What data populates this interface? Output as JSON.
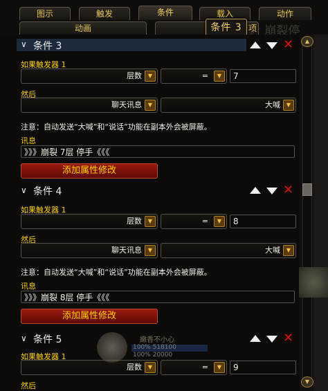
{
  "tabs": [
    {
      "label": "图示"
    },
    {
      "label": "触发"
    },
    {
      "label": "条件"
    },
    {
      "label": "载入"
    },
    {
      "label": "动作"
    },
    {
      "label": "动画"
    },
    {
      "label": "项"
    }
  ],
  "tooltip": {
    "text": "条件 3"
  },
  "background_ghost_text": "》 崩裂停",
  "unit_frame": {
    "name": "嫩香不小心",
    "hp_percent": "100%",
    "hp_value": "518100",
    "mana_percent": "100%",
    "mana_value": "20000"
  },
  "conditions": [
    {
      "title": "条件 3",
      "trigger_label": "如果触发器 1",
      "trigger_field": "层数",
      "operator": "=",
      "value": "7",
      "then_label": "然后",
      "action": "聊天讯息",
      "channel": "大喊",
      "note": "注意：自动发送“大喊”和“说话”功能在副本外会被屏蔽。",
      "message_label": "讯息",
      "message": "》》》崩裂 7层 停手《《《",
      "add_button": "添加属性修改"
    },
    {
      "title": "条件 4",
      "trigger_label": "如果触发器 1",
      "trigger_field": "层数",
      "operator": "=",
      "value": "8",
      "then_label": "然后",
      "action": "聊天讯息",
      "channel": "大喊",
      "note": "注意：自动发送“大喊”和“说话”功能在副本外会被屏蔽。",
      "message_label": "讯息",
      "message": "》》》崩裂 8层 停手《《《",
      "add_button": "添加属性修改"
    },
    {
      "title": "条件 5",
      "trigger_label": "如果触发器 1",
      "trigger_field": "层数",
      "operator": "=",
      "value": "9",
      "then_label": "然后"
    }
  ],
  "colors": {
    "accent_gold": "#ffd200",
    "delete_red": "#e01010",
    "button_red": "#9a1a10",
    "selected_header": "#1d2a3c"
  }
}
